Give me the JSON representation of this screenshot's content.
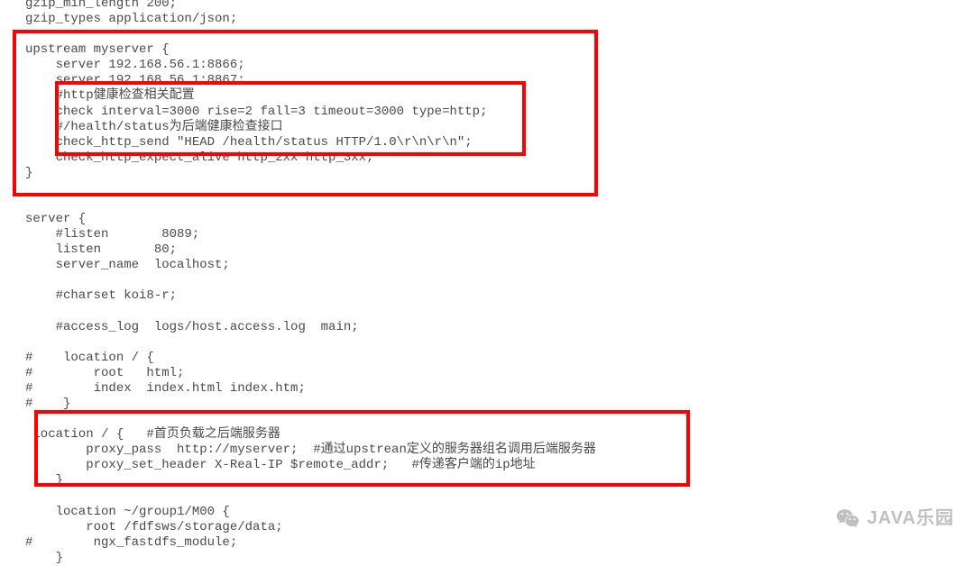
{
  "code_lines": [
    "gzip_min_length 200;",
    "gzip_types application/json;",
    "",
    "upstream myserver {",
    "    server 192.168.56.1:8866;",
    "    server 192.168.56.1:8867;",
    "    #http健康检查相关配置",
    "    check interval=3000 rise=2 fall=3 timeout=3000 type=http;",
    "    #/health/status为后端健康检查接口",
    "    check_http_send \"HEAD /health/status HTTP/1.0\\r\\n\\r\\n\";",
    "    check_http_expect_alive http_2xx http_3xx;",
    "}",
    "",
    "",
    "server {",
    "    #listen       8089;",
    "    listen       80;",
    "    server_name  localhost;",
    "",
    "    #charset koi8-r;",
    "",
    "    #access_log  logs/host.access.log  main;",
    "",
    "#    location / {",
    "#        root   html;",
    "#        index  index.html index.htm;",
    "#    }",
    "",
    " location / {   #首页负载之后端服务器",
    "        proxy_pass  http://myserver;  #通过upstrean定义的服务器组名调用后端服务器",
    "        proxy_set_header X-Real-IP $remote_addr;   #传递客户端的ip地址",
    "    }",
    "",
    "    location ~/group1/M00 {",
    "        root /fdfsws/storage/data;",
    "#        ngx_fastdfs_module;",
    "    }"
  ],
  "watermark": "JAVA乐园"
}
